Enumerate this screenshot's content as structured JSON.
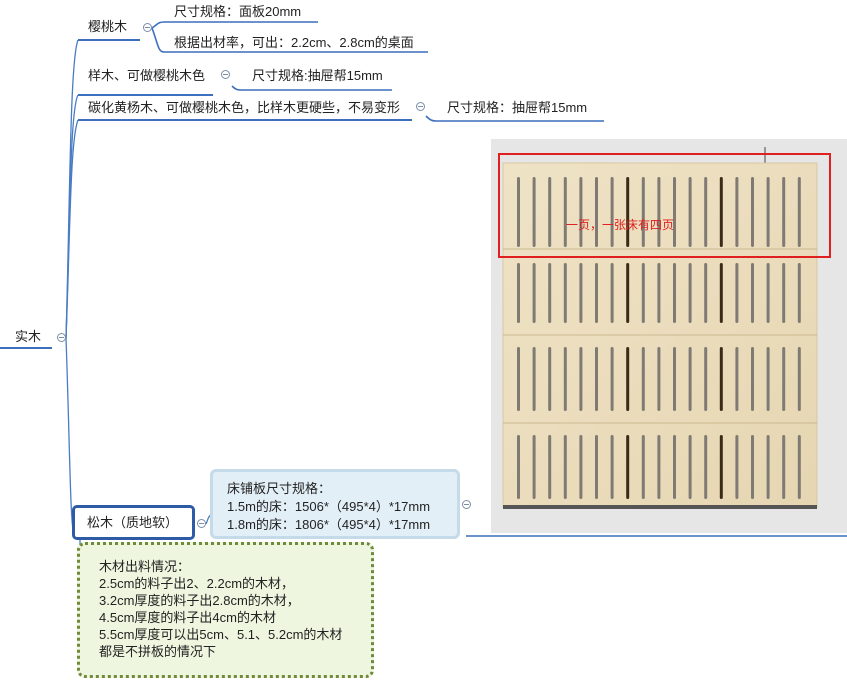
{
  "root": {
    "label": "实木"
  },
  "branches": {
    "yingtao": {
      "label": "樱桃木",
      "children": [
        "尺寸规格：面板20mm",
        "根据出材率，可出：2.2cm、2.8cm的桌面"
      ]
    },
    "yang": {
      "label": "样木、可做樱桃木色",
      "children": [
        "尺寸规格:抽屉帮15mm"
      ]
    },
    "tan": {
      "label": "碳化黄杨木、可做樱桃木色，比样木更硬些，不易变形",
      "children": [
        "尺寸规格：抽屉帮15mm"
      ]
    },
    "song": {
      "label": "松木（质地软）",
      "bed_note": [
        "床铺板尺寸规格：",
        "1.5m的床：1506*（495*4）*17mm",
        "1.8m的床：1806*（495*4）*17mm"
      ],
      "yield_note": [
        "木材出料情况：",
        "2.5cm的料子出2、2.2cm的木材，",
        "3.2cm厚度的料子出2.8cm的木材，",
        "4.5cm厚度的料子出4cm的木材",
        "5.5cm厚度可以出5cm、5.1、5.2cm的木材",
        "都是不拼板的情况下"
      ]
    }
  },
  "image": {
    "annotation": "一页，一张床有四页"
  },
  "colors": {
    "link": "#4a7cc4",
    "underline": "#3c6fbe",
    "accent_box": "#2e5ba6",
    "note_fill": "#e3eff7",
    "info_fill": "#eef6df",
    "info_border": "#6f8a3a",
    "annotation": "#e02020"
  }
}
